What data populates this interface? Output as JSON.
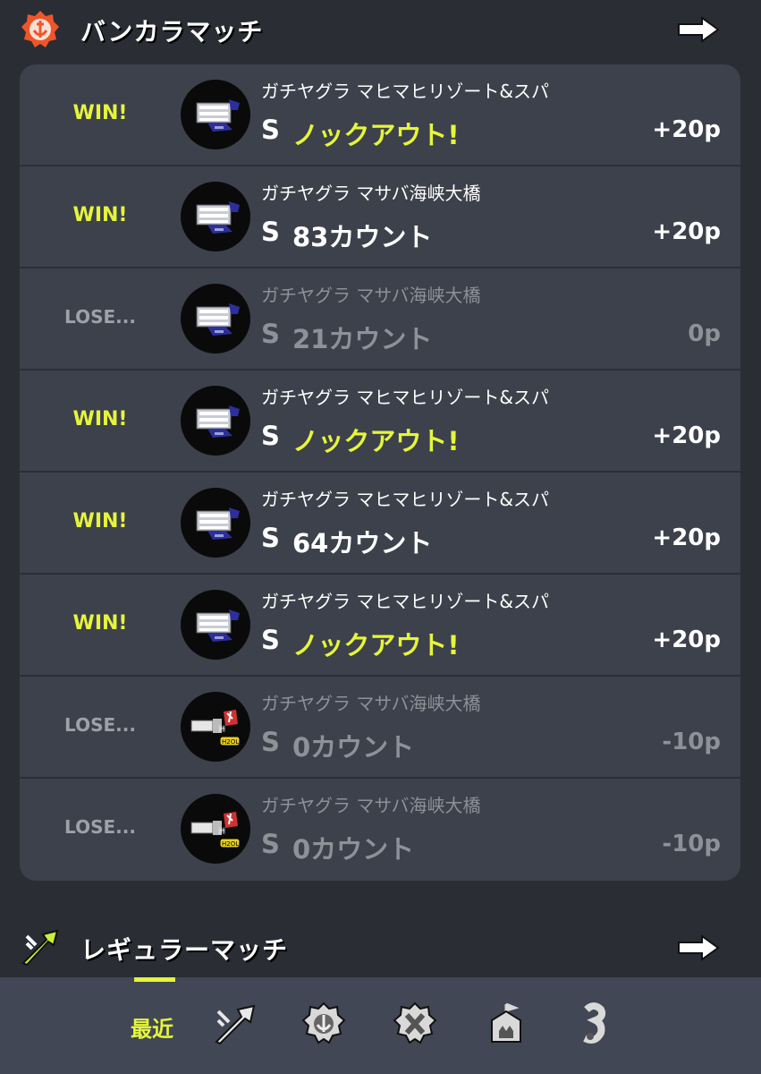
{
  "bankara_section": {
    "title": "バンカラマッチ",
    "icon": "bankara-emblem-icon",
    "arrow_icon": "arrow-right-icon"
  },
  "matches": [
    {
      "result": "WIN!",
      "mode_stage": "ガチヤグラ マヒマヒリゾート&スパ",
      "rank": "S",
      "score": "ノックアウト!",
      "points": "+20p",
      "weapon": "weapon-icon-blaster",
      "won": true
    },
    {
      "result": "WIN!",
      "mode_stage": "ガチヤグラ マサバ海峡大橋",
      "rank": "S",
      "score": "83カウント",
      "points": "+20p",
      "weapon": "weapon-icon-blaster",
      "won": true
    },
    {
      "result": "LOSE...",
      "mode_stage": "ガチヤグラ マサバ海峡大橋",
      "rank": "S",
      "score": "21カウント",
      "points": "0p",
      "weapon": "weapon-icon-blaster",
      "won": false
    },
    {
      "result": "WIN!",
      "mode_stage": "ガチヤグラ マヒマヒリゾート&スパ",
      "rank": "S",
      "score": "ノックアウト!",
      "points": "+20p",
      "weapon": "weapon-icon-blaster",
      "won": true
    },
    {
      "result": "WIN!",
      "mode_stage": "ガチヤグラ マヒマヒリゾート&スパ",
      "rank": "S",
      "score": "64カウント",
      "points": "+20p",
      "weapon": "weapon-icon-blaster",
      "won": true
    },
    {
      "result": "WIN!",
      "mode_stage": "ガチヤグラ マヒマヒリゾート&スパ",
      "rank": "S",
      "score": "ノックアウト!",
      "points": "+20p",
      "weapon": "weapon-icon-blaster",
      "won": true
    },
    {
      "result": "LOSE...",
      "mode_stage": "ガチヤグラ マサバ海峡大橋",
      "rank": "S",
      "score": "0カウント",
      "points": "-10p",
      "weapon": "weapon-icon-shooter",
      "won": false
    },
    {
      "result": "LOSE...",
      "mode_stage": "ガチヤグラ マサバ海峡大橋",
      "rank": "S",
      "score": "0カウント",
      "points": "-10p",
      "weapon": "weapon-icon-shooter",
      "won": false
    }
  ],
  "regular_section": {
    "title": "レギュラーマッチ",
    "icon": "regular-splat-icon",
    "arrow_icon": "arrow-right-icon"
  },
  "tabbar": {
    "recent_label": "最近",
    "tabs": [
      "regular-match-icon",
      "bankara-match-icon",
      "x-match-icon",
      "event-match-icon",
      "private-match-icon"
    ]
  },
  "colors": {
    "accent": "#e6f53a",
    "bankara": "#f0552a",
    "regular": "#c7f03b",
    "background": "#2a2d34",
    "panel": "#3c414b"
  }
}
